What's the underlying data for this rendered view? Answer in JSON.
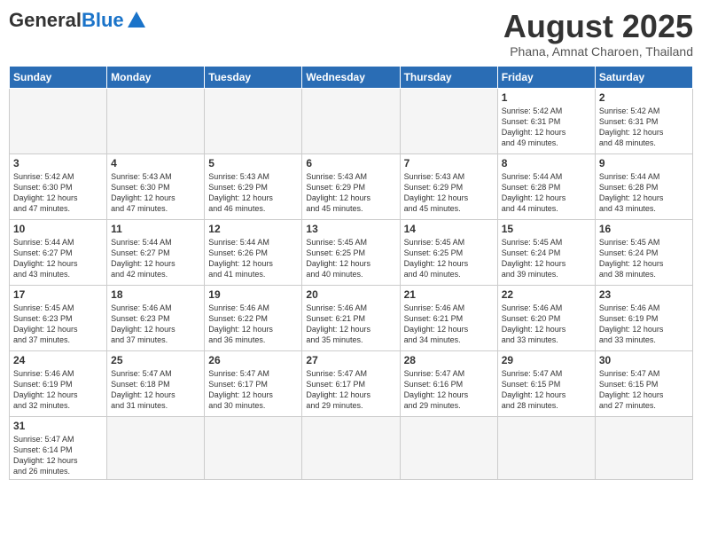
{
  "header": {
    "logo_general": "General",
    "logo_blue": "Blue",
    "title": "August 2025",
    "subtitle": "Phana, Amnat Charoen, Thailand"
  },
  "days_of_week": [
    "Sunday",
    "Monday",
    "Tuesday",
    "Wednesday",
    "Thursday",
    "Friday",
    "Saturday"
  ],
  "weeks": [
    {
      "days": [
        {
          "num": "",
          "info": ""
        },
        {
          "num": "",
          "info": ""
        },
        {
          "num": "",
          "info": ""
        },
        {
          "num": "",
          "info": ""
        },
        {
          "num": "",
          "info": ""
        },
        {
          "num": "1",
          "info": "Sunrise: 5:42 AM\nSunset: 6:31 PM\nDaylight: 12 hours\nand 49 minutes."
        },
        {
          "num": "2",
          "info": "Sunrise: 5:42 AM\nSunset: 6:31 PM\nDaylight: 12 hours\nand 48 minutes."
        }
      ]
    },
    {
      "days": [
        {
          "num": "3",
          "info": "Sunrise: 5:42 AM\nSunset: 6:30 PM\nDaylight: 12 hours\nand 47 minutes."
        },
        {
          "num": "4",
          "info": "Sunrise: 5:43 AM\nSunset: 6:30 PM\nDaylight: 12 hours\nand 47 minutes."
        },
        {
          "num": "5",
          "info": "Sunrise: 5:43 AM\nSunset: 6:29 PM\nDaylight: 12 hours\nand 46 minutes."
        },
        {
          "num": "6",
          "info": "Sunrise: 5:43 AM\nSunset: 6:29 PM\nDaylight: 12 hours\nand 45 minutes."
        },
        {
          "num": "7",
          "info": "Sunrise: 5:43 AM\nSunset: 6:29 PM\nDaylight: 12 hours\nand 45 minutes."
        },
        {
          "num": "8",
          "info": "Sunrise: 5:44 AM\nSunset: 6:28 PM\nDaylight: 12 hours\nand 44 minutes."
        },
        {
          "num": "9",
          "info": "Sunrise: 5:44 AM\nSunset: 6:28 PM\nDaylight: 12 hours\nand 43 minutes."
        }
      ]
    },
    {
      "days": [
        {
          "num": "10",
          "info": "Sunrise: 5:44 AM\nSunset: 6:27 PM\nDaylight: 12 hours\nand 43 minutes."
        },
        {
          "num": "11",
          "info": "Sunrise: 5:44 AM\nSunset: 6:27 PM\nDaylight: 12 hours\nand 42 minutes."
        },
        {
          "num": "12",
          "info": "Sunrise: 5:44 AM\nSunset: 6:26 PM\nDaylight: 12 hours\nand 41 minutes."
        },
        {
          "num": "13",
          "info": "Sunrise: 5:45 AM\nSunset: 6:25 PM\nDaylight: 12 hours\nand 40 minutes."
        },
        {
          "num": "14",
          "info": "Sunrise: 5:45 AM\nSunset: 6:25 PM\nDaylight: 12 hours\nand 40 minutes."
        },
        {
          "num": "15",
          "info": "Sunrise: 5:45 AM\nSunset: 6:24 PM\nDaylight: 12 hours\nand 39 minutes."
        },
        {
          "num": "16",
          "info": "Sunrise: 5:45 AM\nSunset: 6:24 PM\nDaylight: 12 hours\nand 38 minutes."
        }
      ]
    },
    {
      "days": [
        {
          "num": "17",
          "info": "Sunrise: 5:45 AM\nSunset: 6:23 PM\nDaylight: 12 hours\nand 37 minutes."
        },
        {
          "num": "18",
          "info": "Sunrise: 5:46 AM\nSunset: 6:23 PM\nDaylight: 12 hours\nand 37 minutes."
        },
        {
          "num": "19",
          "info": "Sunrise: 5:46 AM\nSunset: 6:22 PM\nDaylight: 12 hours\nand 36 minutes."
        },
        {
          "num": "20",
          "info": "Sunrise: 5:46 AM\nSunset: 6:21 PM\nDaylight: 12 hours\nand 35 minutes."
        },
        {
          "num": "21",
          "info": "Sunrise: 5:46 AM\nSunset: 6:21 PM\nDaylight: 12 hours\nand 34 minutes."
        },
        {
          "num": "22",
          "info": "Sunrise: 5:46 AM\nSunset: 6:20 PM\nDaylight: 12 hours\nand 33 minutes."
        },
        {
          "num": "23",
          "info": "Sunrise: 5:46 AM\nSunset: 6:19 PM\nDaylight: 12 hours\nand 33 minutes."
        }
      ]
    },
    {
      "days": [
        {
          "num": "24",
          "info": "Sunrise: 5:46 AM\nSunset: 6:19 PM\nDaylight: 12 hours\nand 32 minutes."
        },
        {
          "num": "25",
          "info": "Sunrise: 5:47 AM\nSunset: 6:18 PM\nDaylight: 12 hours\nand 31 minutes."
        },
        {
          "num": "26",
          "info": "Sunrise: 5:47 AM\nSunset: 6:17 PM\nDaylight: 12 hours\nand 30 minutes."
        },
        {
          "num": "27",
          "info": "Sunrise: 5:47 AM\nSunset: 6:17 PM\nDaylight: 12 hours\nand 29 minutes."
        },
        {
          "num": "28",
          "info": "Sunrise: 5:47 AM\nSunset: 6:16 PM\nDaylight: 12 hours\nand 29 minutes."
        },
        {
          "num": "29",
          "info": "Sunrise: 5:47 AM\nSunset: 6:15 PM\nDaylight: 12 hours\nand 28 minutes."
        },
        {
          "num": "30",
          "info": "Sunrise: 5:47 AM\nSunset: 6:15 PM\nDaylight: 12 hours\nand 27 minutes."
        }
      ]
    },
    {
      "days": [
        {
          "num": "31",
          "info": "Sunrise: 5:47 AM\nSunset: 6:14 PM\nDaylight: 12 hours\nand 26 minutes."
        },
        {
          "num": "",
          "info": ""
        },
        {
          "num": "",
          "info": ""
        },
        {
          "num": "",
          "info": ""
        },
        {
          "num": "",
          "info": ""
        },
        {
          "num": "",
          "info": ""
        },
        {
          "num": "",
          "info": ""
        }
      ]
    }
  ]
}
